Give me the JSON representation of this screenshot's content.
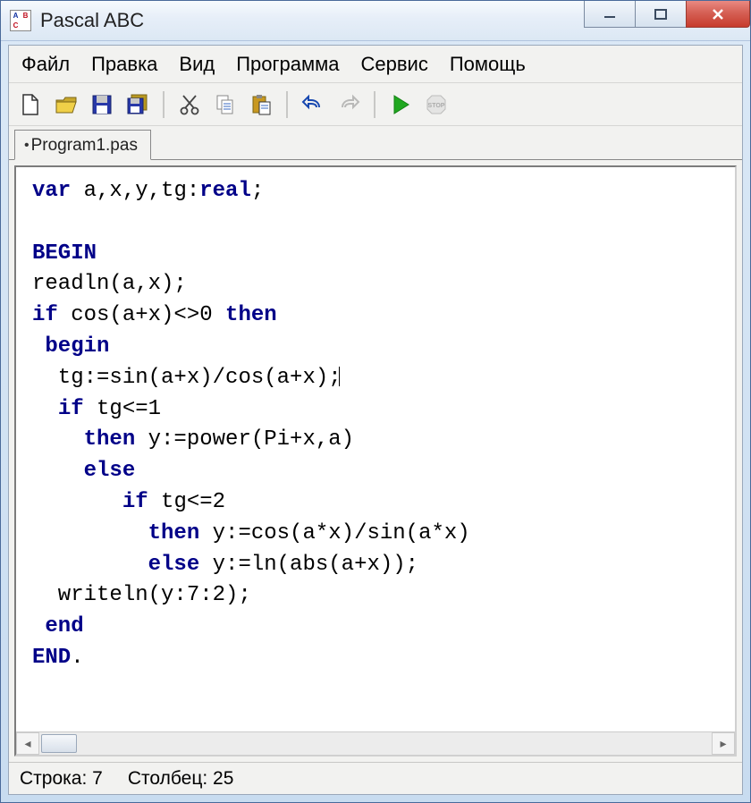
{
  "window": {
    "title": "Pascal ABC",
    "app_icon_letters": [
      "A",
      "B",
      "C"
    ]
  },
  "menu": {
    "items": [
      "Файл",
      "Правка",
      "Вид",
      "Программа",
      "Сервис",
      "Помощь"
    ]
  },
  "toolbar": {
    "icons": [
      "new",
      "open",
      "save",
      "save-all",
      "cut",
      "copy",
      "paste",
      "undo",
      "redo",
      "run",
      "stop"
    ]
  },
  "tabs": [
    {
      "label": "Program1.pas",
      "dirty": true,
      "active": true
    }
  ],
  "editor": {
    "lines": [
      {
        "t": "var",
        "rest": " a,x,y,tg:",
        "kw2": "real",
        "tail": ";"
      },
      {
        "t": ""
      },
      {
        "t": "BEGIN"
      },
      {
        "plain": "readln(a,x);"
      },
      {
        "t": "if",
        "rest": " cos(a+x)<>0 ",
        "kw2": "then"
      },
      {
        "indent": " ",
        "t": "begin"
      },
      {
        "plain": "  tg:=sin(a+x)/cos(a+x);",
        "caret": true
      },
      {
        "indent": "  ",
        "t": "if",
        "rest": " tg<=1"
      },
      {
        "indent": "    ",
        "t": "then",
        "rest": " y:=power(Pi+x,a)"
      },
      {
        "indent": "    ",
        "t": "else"
      },
      {
        "indent": "       ",
        "t": "if",
        "rest": " tg<=2"
      },
      {
        "indent": "         ",
        "t": "then",
        "rest": " y:=cos(a*x)/sin(a*x)"
      },
      {
        "indent": "         ",
        "t": "else",
        "rest": " y:=ln(abs(a+x));"
      },
      {
        "plain": "  writeln(y:7:2);"
      },
      {
        "indent": " ",
        "t": "end"
      },
      {
        "t": "END",
        "tail": "."
      }
    ]
  },
  "status": {
    "line_label": "Строка:",
    "line_value": "7",
    "col_label": "Столбец:",
    "col_value": "25"
  }
}
